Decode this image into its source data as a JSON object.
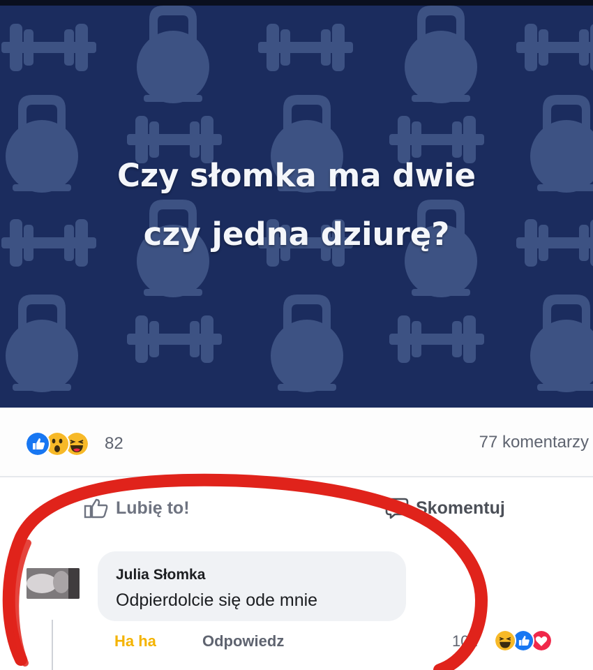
{
  "post": {
    "title_line1": "Czy słomka ma dwie",
    "title_line2": "czy jedna dziurę?",
    "pattern_icons": [
      "dumbbell-icon",
      "kettlebell-icon"
    ],
    "background_color": "#1b2c5e",
    "icon_color": "#3d5283"
  },
  "summary": {
    "reactions": [
      "like-icon",
      "wow-icon",
      "haha-icon"
    ],
    "reaction_count": "82",
    "comment_count": "77 komentarzy"
  },
  "actions": {
    "like_label": "Lubię to!",
    "comment_label": "Skomentuj"
  },
  "comment": {
    "author": "Julia Słomka",
    "text": "Odpierdolcie się ode mnie",
    "haha_label": "Ha ha",
    "reply_label": "Odpowiedz",
    "reaction_count": "101",
    "reactions": [
      "haha-icon",
      "like-icon",
      "love-icon"
    ]
  },
  "colors": {
    "facebook_blue": "#1877f2",
    "haha_yellow": "#f7b928",
    "love_red": "#f0284a",
    "annotation_red": "#e0231b"
  }
}
